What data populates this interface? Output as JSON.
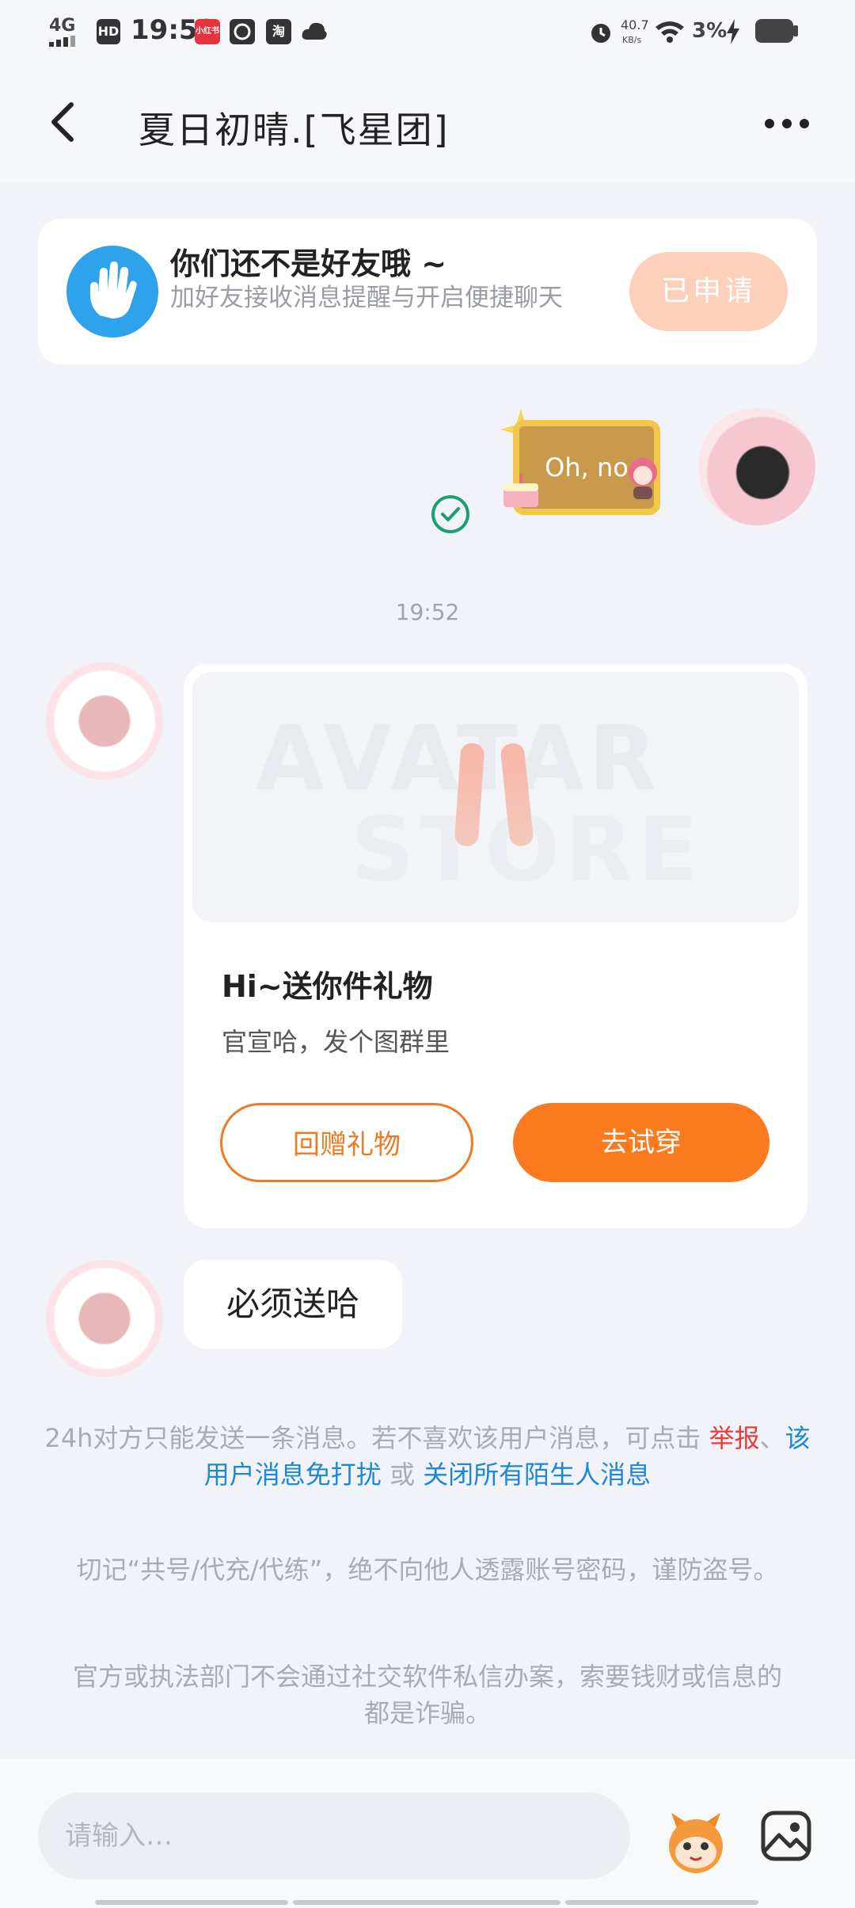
{
  "status_bar": {
    "network": "4G",
    "hd": "HD",
    "time": "19:52",
    "app_icon_1": "小红书",
    "app_icon_3": "淘",
    "net_speed": "40.7",
    "net_speed_unit": "KB/s",
    "battery": "3%"
  },
  "header": {
    "title": "夏日初晴.[飞星团]"
  },
  "friend_card": {
    "title": "你们还不是好友哦 ~",
    "desc": "加好友接收消息提醒与开启便捷聊天",
    "button": "已申请"
  },
  "sent_sticker": {
    "text": "Oh, no"
  },
  "chat": {
    "timestamp": "19:52",
    "gift": {
      "watermark_1": "AVATAR",
      "watermark_2": "STORE",
      "title": "Hi~送你件礼物",
      "subtitle": "官宣哈，发个图群里",
      "return_button": "回赠礼物",
      "try_button": "去试穿"
    },
    "message": "必须送哈"
  },
  "notice": {
    "prefix": "24h对方只能发送一条消息。若不喜欢该用户消息，可点击 ",
    "report": "举报",
    "sep": "、",
    "mute": "该用户消息免打扰",
    "or": " 或 ",
    "close_all": "关闭所有陌生人消息"
  },
  "warnings": {
    "line1": "切记“共号/代充/代练”，绝不向他人透露账号密码，谨防盗号。",
    "line2": "官方或执法部门不会通过社交软件私信办案，索要钱财或信息的都是诈骗。"
  },
  "input": {
    "placeholder": "请输入…"
  },
  "colors": {
    "accent_orange": "#fb7a1f",
    "friend_icon_blue": "#2ea3ec",
    "applied_button": "#fdd0bc",
    "link_blue": "#1c88d6",
    "report_red": "#ea3b3b"
  }
}
